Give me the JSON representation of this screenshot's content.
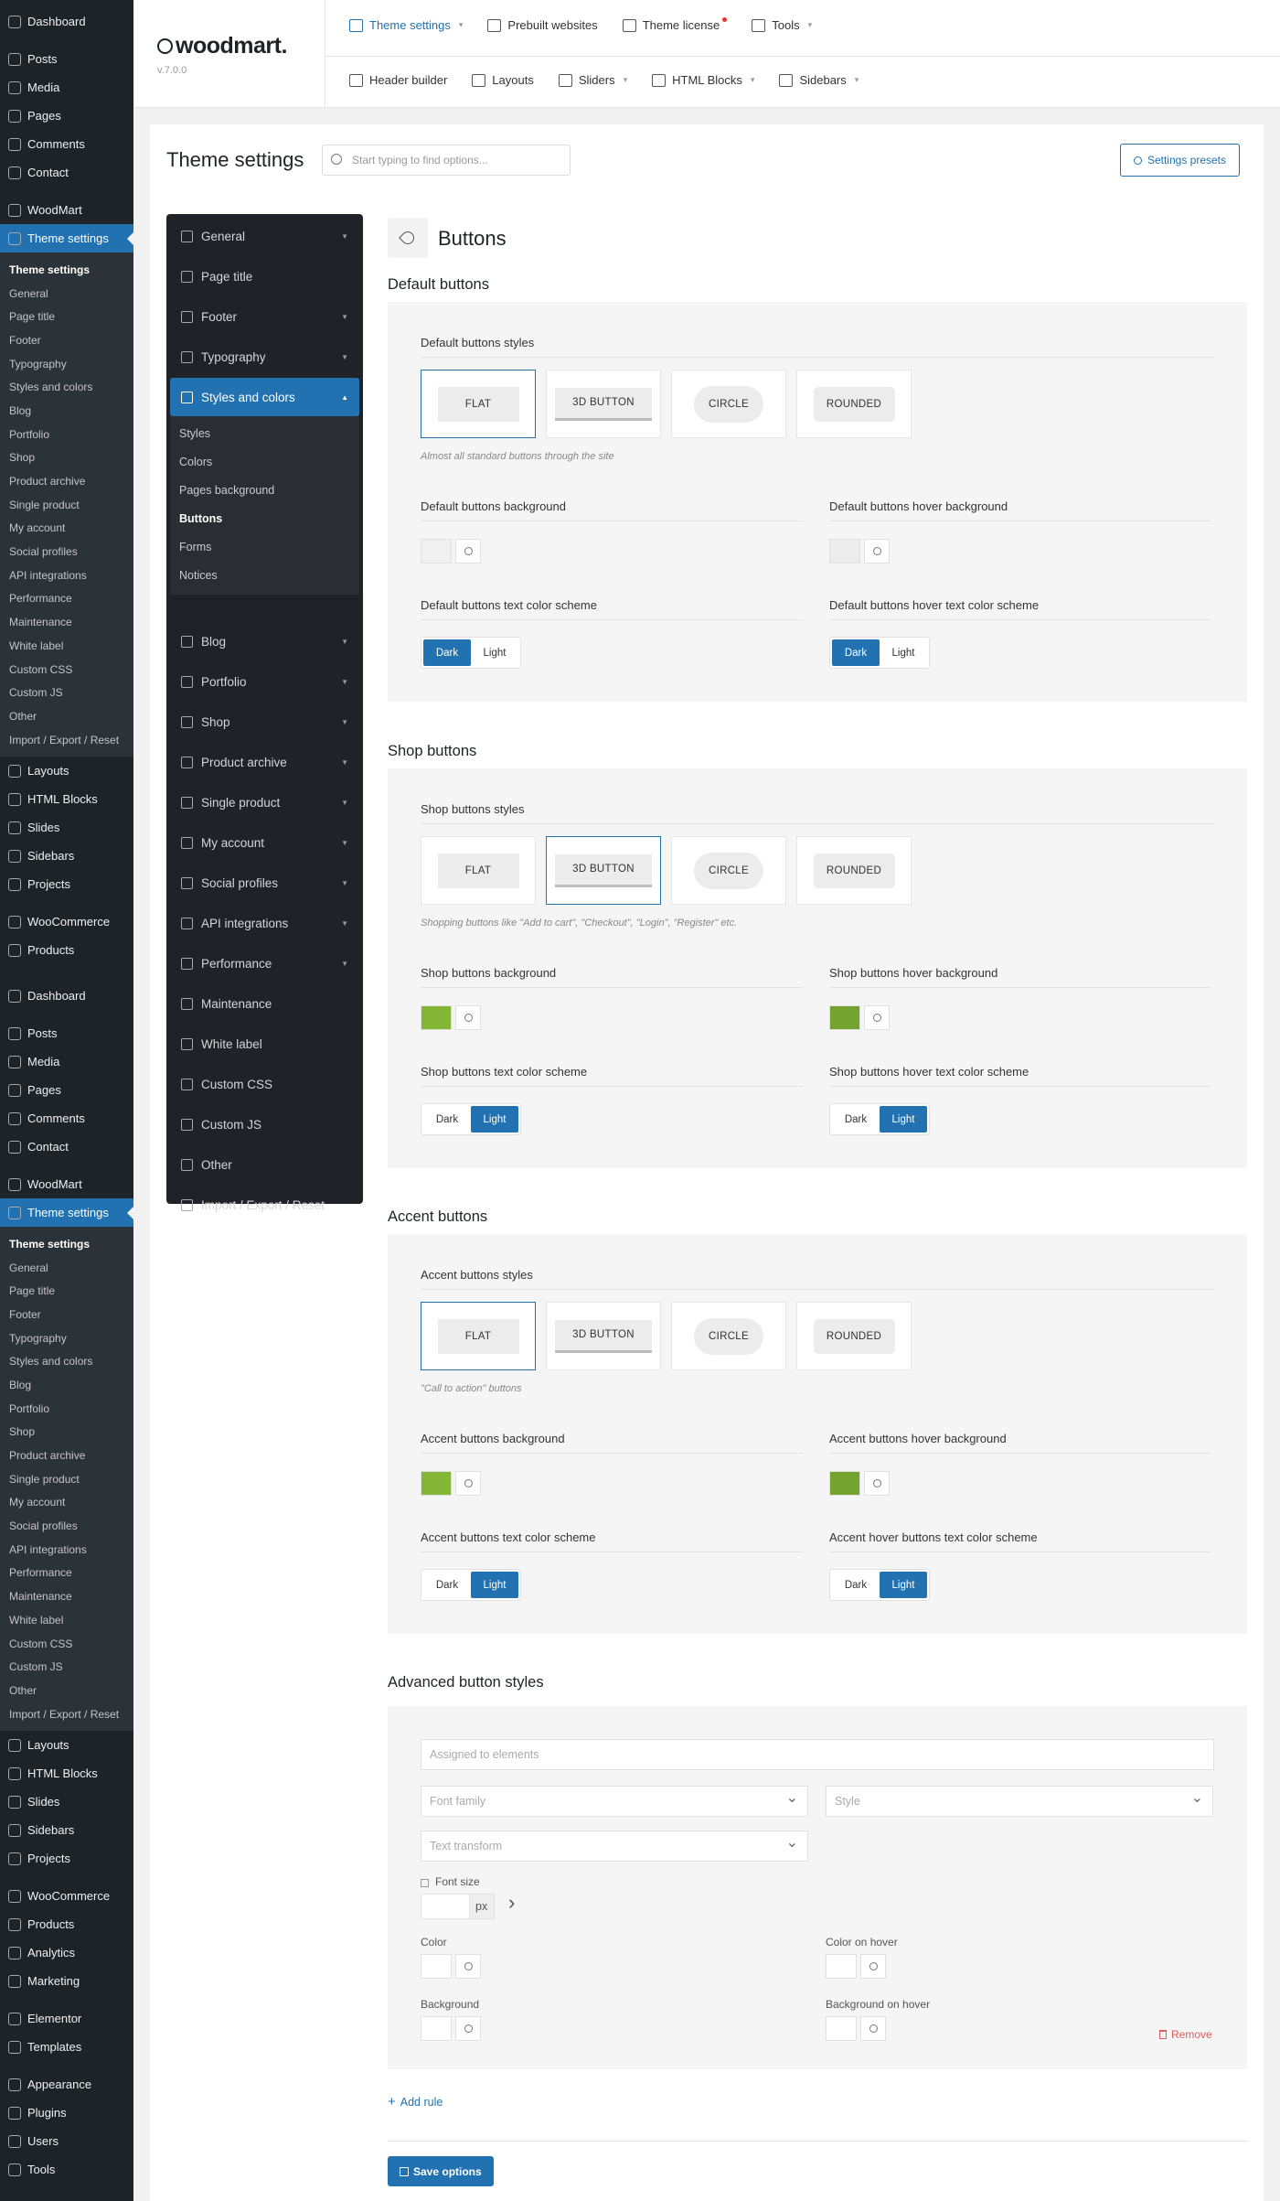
{
  "wp_menu": {
    "top": [
      {
        "label": "Dashboard",
        "icon": "dashboard-icon"
      },
      {
        "label": "Posts",
        "icon": "pin-icon"
      },
      {
        "label": "Media",
        "icon": "media-icon"
      },
      {
        "label": "Pages",
        "icon": "pages-icon"
      },
      {
        "label": "Comments",
        "icon": "comments-icon"
      },
      {
        "label": "Contact",
        "icon": "mail-icon"
      },
      {
        "label": "WoodMart",
        "icon": "woodmart-icon"
      },
      {
        "label": "Theme settings",
        "icon": "sliders-icon"
      }
    ],
    "sub": [
      "Theme settings",
      "General",
      "Page title",
      "Footer",
      "Typography",
      "Styles and colors",
      "Blog",
      "Portfolio",
      "Shop",
      "Product archive",
      "Single product",
      "My account",
      "Social profiles",
      "API integrations",
      "Performance",
      "Maintenance",
      "White label",
      "Custom CSS",
      "Custom JS",
      "Other",
      "Import / Export / Reset"
    ],
    "after": [
      {
        "label": "Layouts",
        "icon": "layers-icon"
      },
      {
        "label": "HTML Blocks",
        "icon": "html-icon"
      },
      {
        "label": "Slides",
        "icon": "slides-icon"
      },
      {
        "label": "Sidebars",
        "icon": "sidebar-icon"
      },
      {
        "label": "Projects",
        "icon": "projects-icon"
      },
      {
        "label": "WooCommerce",
        "icon": "woo-icon"
      },
      {
        "label": "Products",
        "icon": "products-icon"
      }
    ],
    "after2": [
      {
        "label": "Layouts",
        "icon": "layers-icon"
      },
      {
        "label": "HTML Blocks",
        "icon": "html-icon"
      },
      {
        "label": "Slides",
        "icon": "slides-icon"
      },
      {
        "label": "Sidebars",
        "icon": "sidebar-icon"
      },
      {
        "label": "Projects",
        "icon": "projects-icon"
      },
      {
        "label": "WooCommerce",
        "icon": "woo-icon"
      },
      {
        "label": "Products",
        "icon": "products-icon"
      },
      {
        "label": "Analytics",
        "icon": "analytics-icon"
      },
      {
        "label": "Marketing",
        "icon": "marketing-icon"
      },
      {
        "label": "Elementor",
        "icon": "elementor-icon"
      },
      {
        "label": "Templates",
        "icon": "templates-icon"
      },
      {
        "label": "Appearance",
        "icon": "appearance-icon"
      },
      {
        "label": "Plugins",
        "icon": "plugins-icon"
      },
      {
        "label": "Users",
        "icon": "users-icon"
      },
      {
        "label": "Tools",
        "icon": "tools-icon"
      }
    ]
  },
  "header": {
    "brand": "woodmart.",
    "version": "v.7.0.0",
    "nav1": [
      {
        "label": "Theme settings",
        "icon": "sliders-icon",
        "active": true,
        "caret": true
      },
      {
        "label": "Prebuilt websites",
        "icon": "grid-icon"
      },
      {
        "label": "Theme license",
        "icon": "key-icon",
        "dot": true
      },
      {
        "label": "Tools",
        "icon": "wrench-icon",
        "caret": true
      }
    ],
    "nav2": [
      {
        "label": "Header builder",
        "icon": "header-icon"
      },
      {
        "label": "Layouts",
        "icon": "layers-icon"
      },
      {
        "label": "Sliders",
        "icon": "slides-icon",
        "caret": true
      },
      {
        "label": "HTML Blocks",
        "icon": "html-icon",
        "caret": true
      },
      {
        "label": "Sidebars",
        "icon": "sidebar-icon",
        "caret": true
      }
    ]
  },
  "page": {
    "title": "Theme settings",
    "search_placeholder": "Start typing to find options...",
    "presets_label": "Settings presets"
  },
  "options_nav": {
    "items": [
      "General",
      "Page title",
      "Footer",
      "Typography",
      "Styles and colors",
      "Blog",
      "Portfolio",
      "Shop",
      "Product archive",
      "Single product",
      "My account",
      "Social profiles",
      "API integrations",
      "Performance",
      "Maintenance",
      "White label",
      "Custom CSS",
      "Custom JS",
      "Other",
      "Import / Export / Reset"
    ],
    "sub": [
      "Styles",
      "Colors",
      "Pages background",
      "Buttons",
      "Forms",
      "Notices"
    ]
  },
  "content": {
    "title": "Buttons",
    "style_options": [
      "FLAT",
      "3D BUTTON",
      "CIRCLE",
      "ROUNDED"
    ],
    "default": {
      "section": "Default buttons",
      "styles_label": "Default buttons styles",
      "hint": "Almost all standard buttons through the site",
      "bg_label": "Default buttons background",
      "hover_bg_label": "Default buttons hover background",
      "text_label": "Default buttons text color scheme",
      "hover_text_label": "Default buttons hover text color scheme",
      "selected": "FLAT",
      "bg_color": "#f0f0f0",
      "hover_bg_color": "#ececec",
      "text_scheme": "Dark",
      "hover_text_scheme": "Dark"
    },
    "shop": {
      "section": "Shop buttons",
      "styles_label": "Shop buttons styles",
      "hint": "Shopping buttons like \"Add to cart\", \"Checkout\", \"Login\", \"Register\" etc.",
      "bg_label": "Shop buttons background",
      "hover_bg_label": "Shop buttons hover background",
      "text_label": "Shop buttons text color scheme",
      "hover_text_label": "Shop buttons hover text color scheme",
      "selected": "3D BUTTON",
      "bg_color": "#83b735",
      "hover_bg_color": "#74a32f",
      "text_scheme": "Light",
      "hover_text_scheme": "Light"
    },
    "accent": {
      "section": "Accent buttons",
      "styles_label": "Accent buttons styles",
      "hint": "\"Call to action\" buttons",
      "bg_label": "Accent buttons background",
      "hover_bg_label": "Accent buttons hover background",
      "text_label": "Accent buttons text color scheme",
      "hover_text_label": "Accent hover buttons text color scheme",
      "selected": "FLAT",
      "bg_color": "#83b735",
      "hover_bg_color": "#74a32f",
      "text_scheme": "Light",
      "hover_text_scheme": "Light"
    },
    "scheme_options": [
      "Dark",
      "Light"
    ],
    "advanced": {
      "section": "Advanced button styles",
      "assigned_placeholder": "Assigned to elements",
      "font_family": "Font family",
      "style": "Style",
      "text_transform": "Text transform",
      "font_size": "Font size",
      "unit": "px",
      "color": "Color",
      "color_hover": "Color on hover",
      "background": "Background",
      "background_hover": "Background on hover",
      "remove": "Remove",
      "add_rule": "Add rule",
      "save": "Save options"
    }
  },
  "colors": {
    "accent": "#2271b1",
    "wp_dark": "#1d2327"
  }
}
